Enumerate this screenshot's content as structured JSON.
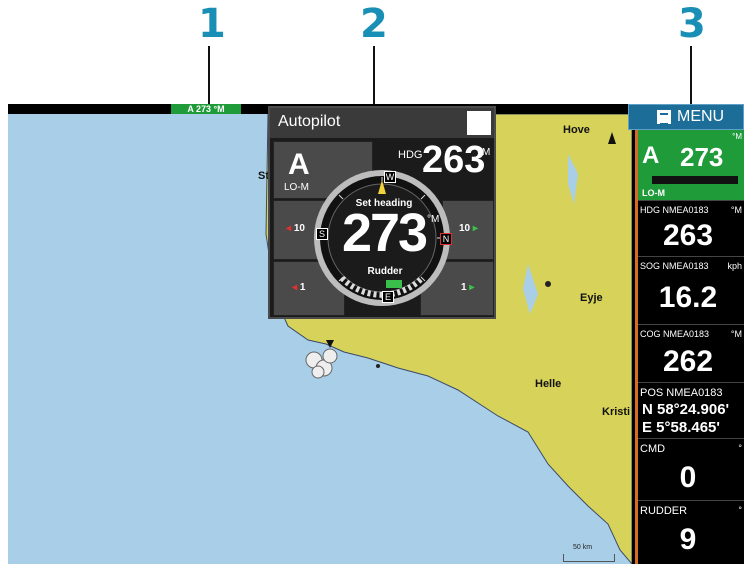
{
  "callouts": [
    "1",
    "2",
    "3"
  ],
  "status_bar": {
    "autopilot_indicator": "A 273 °M",
    "indicator_color": "#1f9b3a"
  },
  "map": {
    "places": [
      "Hove",
      "Eyje",
      "Helle",
      "Kristi",
      "St"
    ],
    "scale_label": "50 km",
    "land_color": "#d7d35a",
    "water_color": "#a9cfe8"
  },
  "autopilot": {
    "title": "Autopilot",
    "close_label": "✕",
    "mode": "A",
    "mode_sub": "LO-M",
    "heading_label": "HDG",
    "heading_value": "263",
    "heading_unit": "°M",
    "set_label": "Set heading",
    "set_value": "273",
    "set_unit": "°M",
    "rudder_label": "Rudder",
    "port10": "10",
    "stbd10": "10",
    "port1": "1",
    "stbd1": "1",
    "compass_letters": [
      "W",
      "N",
      "E",
      "S"
    ]
  },
  "menu": {
    "label": "MENU"
  },
  "panel": {
    "ap_tile": {
      "mode": "A",
      "value": "273",
      "unit": "°M",
      "sub": "LO-M",
      "color": "#1f9b3a"
    },
    "tiles": [
      {
        "label": "HDG NMEA0183",
        "unit": "°M",
        "value": "263"
      },
      {
        "label": "SOG NMEA0183",
        "unit": "kph",
        "value": "16.2"
      },
      {
        "label": "COG NMEA0183",
        "unit": "°M",
        "value": "262"
      }
    ],
    "pos": {
      "label": "POS NMEA0183",
      "lat": "N  58°24.906'",
      "lon": "E   5°58.465'"
    },
    "cmd": {
      "label": "CMD",
      "unit": "°",
      "value": "0"
    },
    "rudder": {
      "label": "RUDDER",
      "unit": "°",
      "value": "9"
    },
    "accent": "#d76b25"
  }
}
